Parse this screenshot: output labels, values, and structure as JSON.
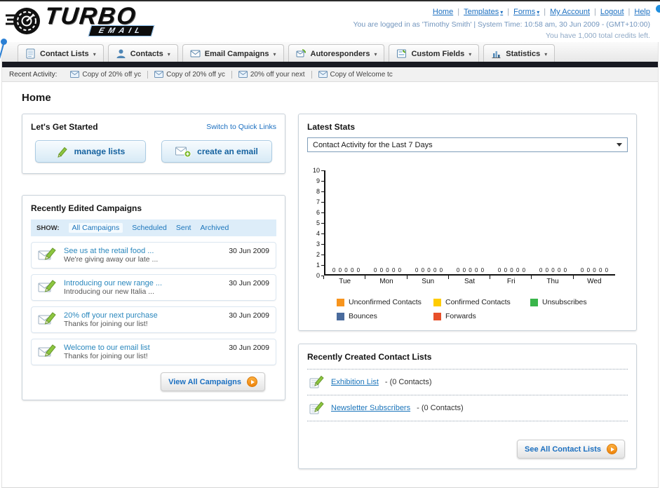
{
  "colors": {
    "link_blue": "#1b75bb",
    "accent_orange": "#f7941d",
    "nav_bar_dark": "#181a22",
    "button_blue": "#1663a0"
  },
  "header": {
    "logo": {
      "title": "TURBO",
      "subtitle": "EMAIL"
    },
    "links": [
      "Home",
      "Templates",
      "Forms",
      "My Account",
      "Logout",
      "Help"
    ],
    "login_info": "You are logged in as 'Timothy Smith' | System Time: 10:58 am, 30 Jun 2009 - (GMT+10:00)",
    "credits_info": "You have 1,000 total credits left."
  },
  "nav": {
    "tabs": [
      {
        "label": "Contact Lists",
        "icon": "contact-lists-icon"
      },
      {
        "label": "Contacts",
        "icon": "contacts-icon"
      },
      {
        "label": "Email Campaigns",
        "icon": "email-campaigns-icon"
      },
      {
        "label": "Autoresponders",
        "icon": "autoresponders-icon"
      },
      {
        "label": "Custom Fields",
        "icon": "custom-fields-icon"
      },
      {
        "label": "Statistics",
        "icon": "statistics-icon"
      }
    ]
  },
  "activity": {
    "label": "Recent Activity:",
    "items": [
      "Copy of 20% off yc",
      "Copy of 20% off yc",
      "20% off your next",
      "Copy of Welcome tc"
    ]
  },
  "page_title": "Home",
  "get_started": {
    "title": "Let's Get Started",
    "switch_link": "Switch to Quick Links",
    "buttons": [
      {
        "label": "manage lists",
        "icon": "pencil-icon"
      },
      {
        "label": "create an email",
        "icon": "envelope-plus-icon"
      }
    ]
  },
  "campaigns": {
    "title": "Recently Edited Campaigns",
    "show_label": "SHOW:",
    "filters": [
      "All Campaigns",
      "Scheduled",
      "Sent",
      "Archived"
    ],
    "active_filter": "All Campaigns",
    "items": [
      {
        "title": "See us at the retail food ...",
        "subtitle": "We're giving away our late ...",
        "date": "30 Jun 2009"
      },
      {
        "title": "Introducing our new range ...",
        "subtitle": "Introducing our new Italia ...",
        "date": "30 Jun 2009"
      },
      {
        "title": "20% off your next purchase",
        "subtitle": "Thanks for joining our list!",
        "date": "30 Jun 2009"
      },
      {
        "title": "Welcome to our email list",
        "subtitle": "Thanks for joining our list!",
        "date": "30 Jun 2009"
      }
    ],
    "view_all_label": "View All Campaigns"
  },
  "stats": {
    "title": "Latest Stats",
    "period_selected": "Contact Activity for the Last 7 Days",
    "chart_data": {
      "type": "bar",
      "title": "Contact Activity for the Last 7 Days",
      "categories": [
        "Tue",
        "Mon",
        "Sun",
        "Sat",
        "Fri",
        "Thu",
        "Wed"
      ],
      "series": [
        {
          "name": "Unconfirmed Contacts",
          "color": "#f7941d",
          "values": [
            0,
            0,
            0,
            0,
            0,
            0,
            0
          ]
        },
        {
          "name": "Confirmed Contacts",
          "color": "#ffcc00",
          "values": [
            0,
            0,
            0,
            0,
            0,
            0,
            0
          ]
        },
        {
          "name": "Unsubscribes",
          "color": "#39b54a",
          "values": [
            0,
            0,
            0,
            0,
            0,
            0,
            0
          ]
        },
        {
          "name": "Bounces",
          "color": "#4a6b9d",
          "values": [
            0,
            0,
            0,
            0,
            0,
            0,
            0
          ]
        },
        {
          "name": "Forwards",
          "color": "#e8502a",
          "values": [
            0,
            0,
            0,
            0,
            0,
            0,
            0
          ]
        }
      ],
      "ylim": [
        0,
        10
      ],
      "ytick_step": 1,
      "grid": false,
      "legend_position": "bottom",
      "show_value_labels": true
    }
  },
  "contact_lists": {
    "title": "Recently Created Contact Lists",
    "items": [
      {
        "name": "Exhibition List",
        "detail": "- (0 Contacts)"
      },
      {
        "name": "Newsletter Subscribers",
        "detail": "- (0 Contacts)"
      }
    ],
    "see_all_label": "See All Contact Lists"
  }
}
